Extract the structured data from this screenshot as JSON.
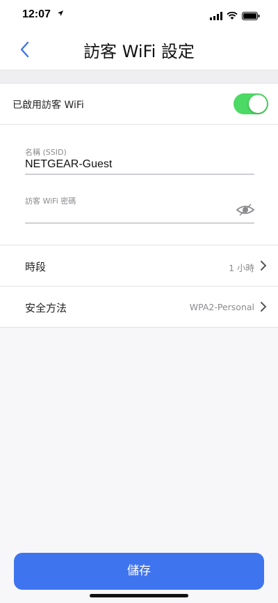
{
  "status_bar": {
    "time": "12:07",
    "location_arrow": "location-arrow-icon"
  },
  "header": {
    "title": "訪客 WiFi 設定",
    "back_icon": "chevron-left-icon"
  },
  "enable_row": {
    "label": "已啟用訪客 WiFi",
    "enabled": true
  },
  "ssid": {
    "label": "名稱 (SSID)",
    "value": "NETGEAR-Guest"
  },
  "password": {
    "label": "訪客 WiFi 密碼",
    "value": "",
    "visibility_icon": "eye-icon"
  },
  "settings": [
    {
      "label": "時段",
      "value": "1 小時"
    },
    {
      "label": "安全方法",
      "value": "WPA2-Personal"
    }
  ],
  "save_button": {
    "label": "儲存"
  },
  "colors": {
    "accent": "#3f74ef",
    "toggle_on": "#4cd964",
    "back_arrow": "#3f74ef"
  }
}
